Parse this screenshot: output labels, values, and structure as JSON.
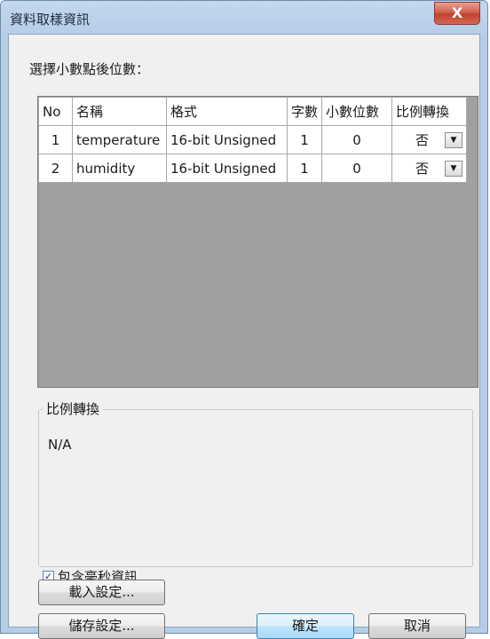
{
  "window": {
    "title": "資料取樣資訊",
    "close_glyph": "X"
  },
  "section_label": "選擇小數點後位數：",
  "table": {
    "headers": [
      "No",
      "名稱",
      "格式",
      "字數",
      "小數位數",
      "比例轉換"
    ],
    "rows": [
      {
        "no": "1",
        "name": "temperature",
        "format": "16-bit Unsigned",
        "words": "1",
        "decimals": "0",
        "ratio": "否"
      },
      {
        "no": "2",
        "name": "humidity",
        "format": "16-bit Unsigned",
        "words": "1",
        "decimals": "0",
        "ratio": "否"
      }
    ]
  },
  "ratio_group": {
    "legend": "比例轉換",
    "value": "N/A"
  },
  "checkbox": {
    "label": "包含毫秒資訊",
    "checked": true,
    "mark": "✓"
  },
  "buttons": {
    "load": "載入設定...",
    "save": "儲存設定...",
    "ok": "確定",
    "cancel": "取消"
  },
  "icons": {
    "dropdown_glyph": "▼"
  },
  "colors": {
    "grid_empty": "#a0a0a0",
    "frame": "#b6cde8",
    "close": "#c0402b"
  }
}
